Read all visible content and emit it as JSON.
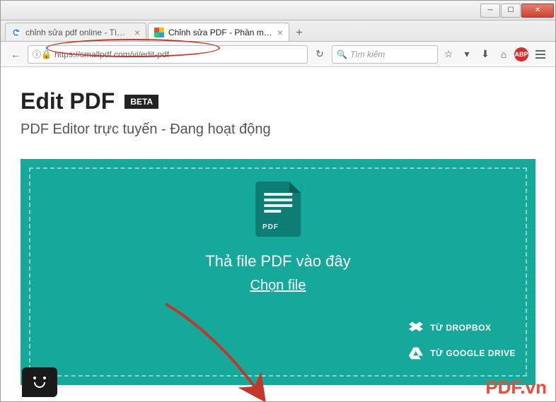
{
  "window": {
    "min": "─",
    "max": "☐",
    "close": "✕"
  },
  "tabs": [
    {
      "label": "chỉnh sửa pdf online - Tìm vớ",
      "active": false
    },
    {
      "label": "Chỉnh sửa PDF - Phần mềm c",
      "active": true
    }
  ],
  "newtab_label": "+",
  "nav": {
    "back": "←",
    "info": "ⓘ",
    "url": "https://smallpdf.com/vi/edit-pdf",
    "reload": "↻",
    "search_placeholder": "Tìm kiếm",
    "abp": "ABP"
  },
  "page": {
    "title": "Edit PDF",
    "badge": "BETA",
    "subtitle": "PDF Editor trực tuyến - Đang hoạt động",
    "pdf_icon_label": "PDF",
    "drop_text": "Thả file PDF vào đây",
    "choose_file": "Chọn file",
    "from_dropbox": "TỪ DROPBOX",
    "from_gdrive": "TỪ GOOGLE DRIVE"
  },
  "watermark": "PDF.vn"
}
